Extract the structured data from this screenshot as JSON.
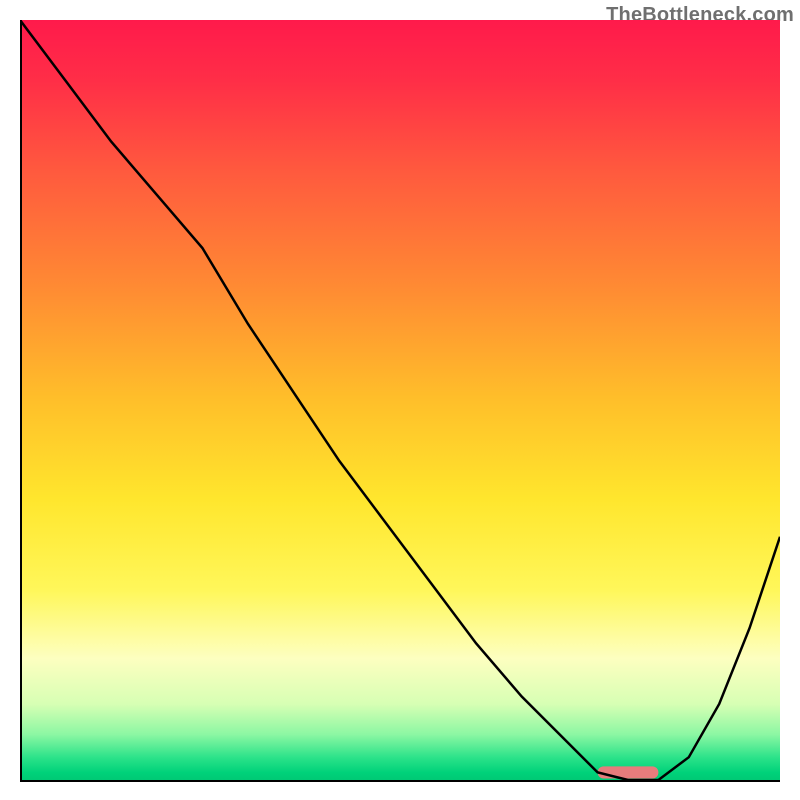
{
  "watermark": "TheBottleneck.com",
  "chart_data": {
    "type": "line",
    "title": "",
    "xlabel": "",
    "ylabel": "",
    "xlim": [
      0,
      100
    ],
    "ylim": [
      0,
      100
    ],
    "grid": false,
    "legend": false,
    "gradient_stops": [
      {
        "offset": 0,
        "color": "#ff1a4b"
      },
      {
        "offset": 8,
        "color": "#ff2e47"
      },
      {
        "offset": 20,
        "color": "#ff5a3e"
      },
      {
        "offset": 35,
        "color": "#ff8a33"
      },
      {
        "offset": 50,
        "color": "#ffbf2a"
      },
      {
        "offset": 63,
        "color": "#ffe62d"
      },
      {
        "offset": 75,
        "color": "#fff75a"
      },
      {
        "offset": 84,
        "color": "#fdffc0"
      },
      {
        "offset": 90,
        "color": "#d7ffb4"
      },
      {
        "offset": 94,
        "color": "#8cf7a3"
      },
      {
        "offset": 97,
        "color": "#2de38a"
      },
      {
        "offset": 99,
        "color": "#00d27a"
      },
      {
        "offset": 100,
        "color": "#00c975"
      }
    ],
    "series": [
      {
        "name": "bottleneck-curve",
        "color": "#000000",
        "x": [
          0,
          6,
          12,
          18,
          24,
          30,
          36,
          42,
          48,
          54,
          60,
          66,
          72,
          76,
          80,
          84,
          88,
          92,
          96,
          100
        ],
        "y": [
          100,
          92,
          84,
          77,
          70,
          60,
          51,
          42,
          34,
          26,
          18,
          11,
          5,
          1,
          0,
          0,
          3,
          10,
          20,
          32
        ]
      }
    ],
    "marker": {
      "name": "optimal-range",
      "color": "#e77c7c",
      "x_start": 76,
      "x_end": 84,
      "y": 1,
      "thickness_pct": 1.6
    }
  }
}
